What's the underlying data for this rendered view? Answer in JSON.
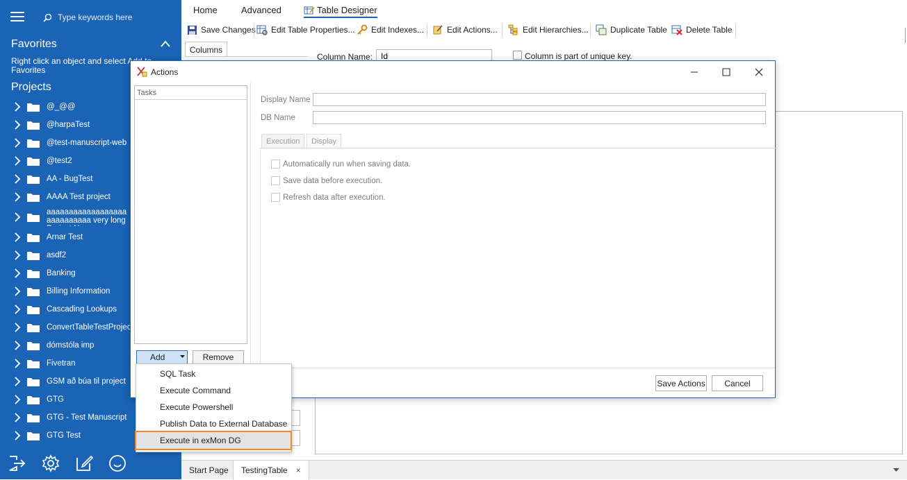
{
  "sidebar": {
    "search_placeholder": "Type keywords here",
    "favorites_title": "Favorites",
    "favorites_hint": "Right click an object and select Add to Favorites",
    "projects_title": "Projects",
    "projects": [
      {
        "label": "@_@@"
      },
      {
        "label": "@harpaTest"
      },
      {
        "label": "@test-manuscript-web"
      },
      {
        "label": "@test2"
      },
      {
        "label": "AA - BugTest"
      },
      {
        "label": "AAAA Test project"
      },
      {
        "label": "aaaaaaaaaaaaaaaaaaaaaaaaaaaa very long Project Name"
      },
      {
        "label": "Arnar Test"
      },
      {
        "label": "asdf2"
      },
      {
        "label": "Banking"
      },
      {
        "label": "Billing Information"
      },
      {
        "label": "Cascading Lookups"
      },
      {
        "label": "ConvertTableTestProject"
      },
      {
        "label": "dómstóla imp"
      },
      {
        "label": "Fivetran"
      },
      {
        "label": "GSM að búa til project"
      },
      {
        "label": "GTG"
      },
      {
        "label": "GTG - Test Manuscript"
      },
      {
        "label": "GTG Test"
      }
    ],
    "bottom_icons": [
      "sign-out-icon",
      "gear-icon",
      "edit-icon",
      "smiley-icon"
    ]
  },
  "ribbon": {
    "tabs": [
      "Home",
      "Advanced",
      "Table Designer"
    ],
    "active_tab": "Table Designer",
    "buttons": {
      "save_changes": "Save Changes",
      "edit_table_properties": "Edit Table Properties...",
      "edit_indexes": "Edit Indexes...",
      "edit_actions": "Edit Actions...",
      "edit_hierarchies": "Edit Hierarchies...",
      "duplicate_table": "Duplicate Table",
      "delete_table": "Delete Table"
    }
  },
  "designer": {
    "columns_tab": "Columns",
    "column_name_label": "Column Name:",
    "column_name_value": "Id",
    "unique_key_label": "Column is part of unique key."
  },
  "doc_tabs": {
    "start_page": "Start Page",
    "testing_table": "TestingTable",
    "close_glyph": "×"
  },
  "dialog": {
    "title": "Actions",
    "tasks_header": "Tasks",
    "display_name_label": "Display Name",
    "db_name_label": "DB Name",
    "sub_tabs": [
      "Execution",
      "Display"
    ],
    "checkboxes": [
      "Automatically run when saving data.",
      "Save data before execution.",
      "Refresh data after execution."
    ],
    "add_button": "Add",
    "remove_button": "Remove",
    "save_actions_button": "Save Actions",
    "cancel_button": "Cancel"
  },
  "add_menu": {
    "items": [
      "SQL Task",
      "Execute Command",
      "Execute Powershell",
      "Publish Data to External Database",
      "Execute in exMon DG"
    ],
    "highlighted_index": 4,
    "highlight_color": "#f28a1d"
  },
  "colors": {
    "sidebar_bg": "#1b63b5",
    "accent": "#1b63b5"
  }
}
